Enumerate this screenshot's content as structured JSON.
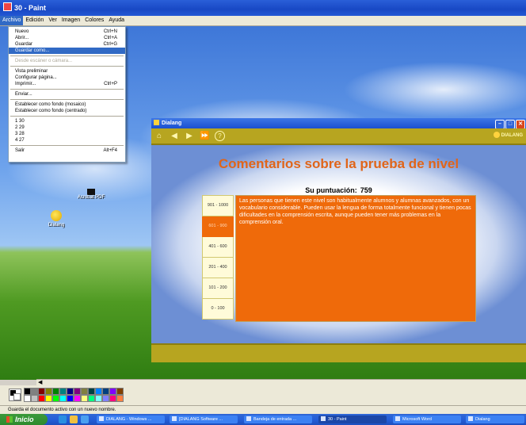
{
  "paint": {
    "title": "30 - Paint",
    "menu": [
      "Archivo",
      "Edición",
      "Ver",
      "Imagen",
      "Colores",
      "Ayuda"
    ],
    "status": "Guarda el documento activo con un nuevo nombre."
  },
  "file_menu": {
    "items": [
      {
        "label": "Nuevo",
        "shortcut": "Ctrl+N"
      },
      {
        "label": "Abrir...",
        "shortcut": "Ctrl+A"
      },
      {
        "label": "Guardar",
        "shortcut": "Ctrl+G"
      },
      {
        "label": "Guardar como...",
        "shortcut": ""
      },
      {
        "label": "Desde escáner o cámara...",
        "shortcut": ""
      },
      {
        "label": "Vista preliminar",
        "shortcut": ""
      },
      {
        "label": "Configurar página...",
        "shortcut": ""
      },
      {
        "label": "Imprimir...",
        "shortcut": "Ctrl+P"
      },
      {
        "label": "Enviar...",
        "shortcut": ""
      },
      {
        "label": "Establecer como fondo (mosaico)",
        "shortcut": ""
      },
      {
        "label": "Establecer como fondo (centrado)",
        "shortcut": ""
      },
      {
        "label": "1 30",
        "shortcut": ""
      },
      {
        "label": "2 29",
        "shortcut": ""
      },
      {
        "label": "3 28",
        "shortcut": ""
      },
      {
        "label": "4 27",
        "shortcut": ""
      },
      {
        "label": "Salir",
        "shortcut": "Alt+F4"
      }
    ]
  },
  "desktop": {
    "icon_label": "Dialang",
    "icon2_label": "Acrobat PDF"
  },
  "dialang": {
    "title": "Dialang",
    "brand": "DIALANG",
    "heading": "Comentarios sobre la prueba de nivel",
    "score_label": "Su puntuación:",
    "score_value": "759",
    "levels": [
      "901 - 1000",
      "601 - 900",
      "401 - 600",
      "201 - 400",
      "101 - 200",
      "0 - 100"
    ],
    "selected_level": "601 - 900",
    "description": "Las personas que tienen este nivel son habitualmente alumnos y alumnas avanzados, con un vocabulario considerable. Pueden usar la lengua de forma totalmente funcional y tienen pocas dificultades en la comprensión escrita, aunque pueden tener más problemas en la comprensión oral."
  },
  "palette": {
    "colors_row1": [
      "#000000",
      "#808080",
      "#800000",
      "#808000",
      "#008000",
      "#008080",
      "#000080",
      "#800080",
      "#808040",
      "#004040",
      "#0080ff",
      "#004080",
      "#8000ff",
      "#804000"
    ],
    "colors_row2": [
      "#ffffff",
      "#c0c0c0",
      "#ff0000",
      "#ffff00",
      "#00ff00",
      "#00ffff",
      "#0000ff",
      "#ff00ff",
      "#ffff80",
      "#00ff80",
      "#80ffff",
      "#8080ff",
      "#ff0080",
      "#ff8040"
    ]
  },
  "taskbar": {
    "start": "Inicio",
    "tasks": [
      {
        "label": "DIALANG - Windows ..."
      },
      {
        "label": "[DIALANG Software ..."
      },
      {
        "label": "Bandeja de entrada ..."
      },
      {
        "label": "30 - Paint"
      },
      {
        "label": "Microsoft Word"
      },
      {
        "label": "Dialang"
      }
    ]
  }
}
